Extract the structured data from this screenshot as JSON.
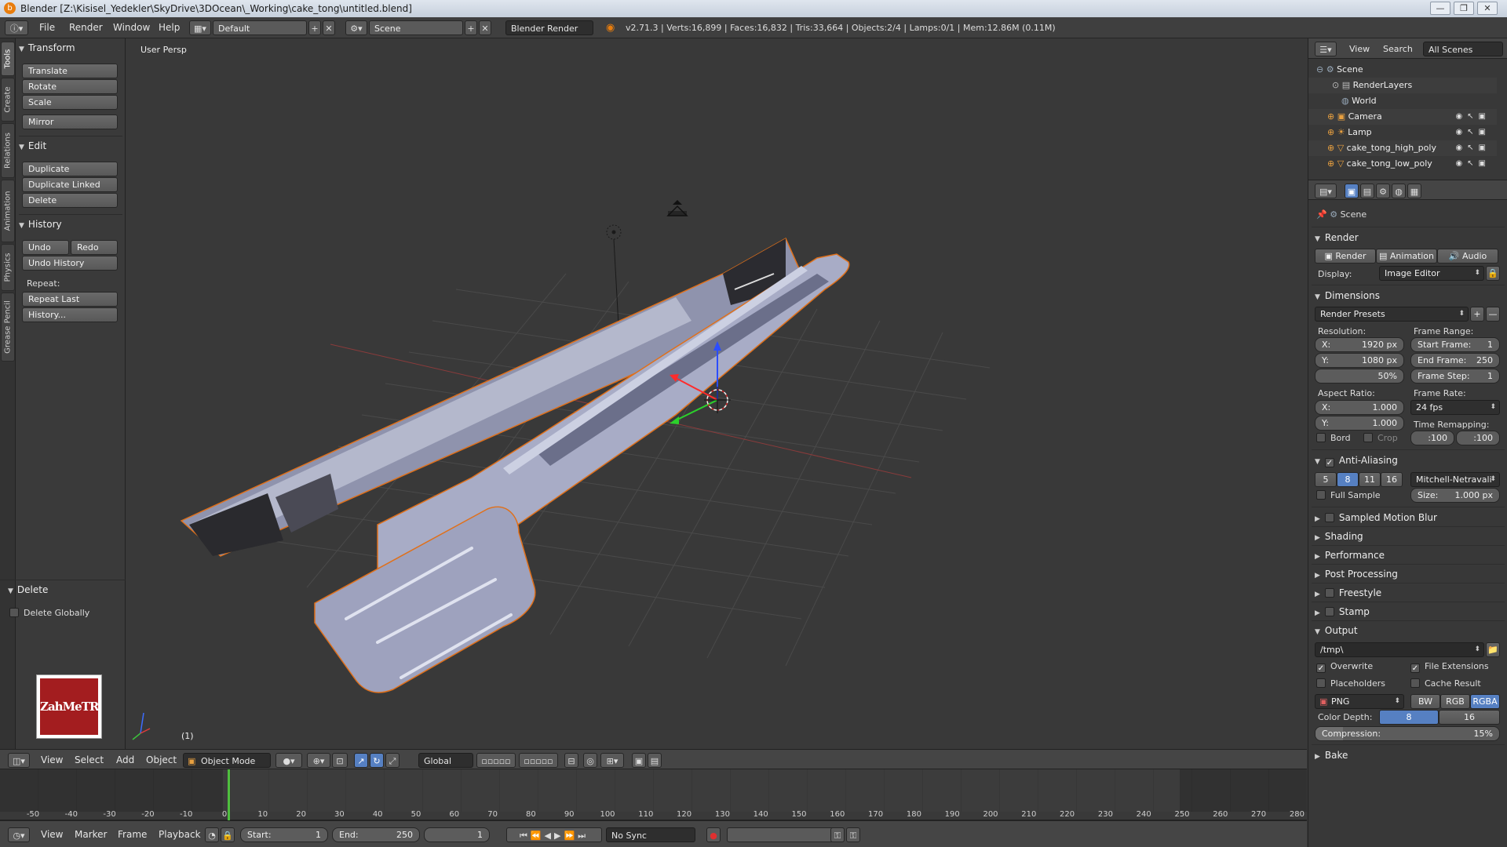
{
  "window": {
    "title": "Blender [Z:\\Kisisel_Yedekler\\SkyDrive\\3DOcean\\_Working\\cake_tong\\untitled.blend]",
    "controls": [
      "—",
      "❐",
      "✕"
    ]
  },
  "info_header": {
    "menus": [
      "File",
      "Render",
      "Window",
      "Help"
    ],
    "screen_layout": "Default",
    "scene": "Scene",
    "render_engine": "Blender Render",
    "stats": "v2.71.3 | Verts:16,899 | Faces:16,832 | Tris:33,664 | Objects:2/4 | Lamps:0/1 | Mem:12.86M (0.11M)"
  },
  "left_tabs": [
    "Tools",
    "Create",
    "Relations",
    "Animation",
    "Physics",
    "Grease Pencil"
  ],
  "tool_shelf": {
    "transform": {
      "title": "Transform",
      "buttons": [
        "Translate",
        "Rotate",
        "Scale",
        "Mirror"
      ]
    },
    "edit": {
      "title": "Edit",
      "buttons": [
        "Duplicate",
        "Duplicate Linked",
        "Delete"
      ]
    },
    "history": {
      "title": "History",
      "undo": "Undo",
      "redo": "Redo",
      "undo_history": "Undo History",
      "repeat_label": "Repeat:",
      "repeat_last": "Repeat Last",
      "history_btn": "History..."
    },
    "operator": {
      "title": "Delete",
      "option": "Delete Globally",
      "option_checked": false
    },
    "logo_text": "ZahMeTR"
  },
  "viewport": {
    "label": "User Persp",
    "frame_indicator": "(1)"
  },
  "view3d_header": {
    "menus": [
      "View",
      "Select",
      "Add",
      "Object"
    ],
    "mode": "Object Mode",
    "orientation": "Global"
  },
  "timeline": {
    "ticks": [
      "-50",
      "-40",
      "-30",
      "-20",
      "-10",
      "0",
      "10",
      "20",
      "30",
      "40",
      "50",
      "60",
      "70",
      "80",
      "90",
      "100",
      "110",
      "120",
      "130",
      "140",
      "150",
      "160",
      "170",
      "180",
      "190",
      "200",
      "210",
      "220",
      "230",
      "240",
      "250",
      "260",
      "270",
      "280"
    ],
    "current_frame": 1,
    "menus": [
      "View",
      "Marker",
      "Frame",
      "Playback"
    ],
    "start_label": "Start:",
    "start": "1",
    "end_label": "End:",
    "end": "250",
    "current": "1",
    "sync": "No Sync"
  },
  "outliner": {
    "menus": [
      "View",
      "Search"
    ],
    "filter": "All Scenes",
    "rows": [
      "Scene",
      "RenderLayers",
      "World",
      "Camera",
      "Lamp",
      "cake_tong_high_poly",
      "cake_tong_low_poly"
    ]
  },
  "properties": {
    "context": "Scene",
    "render": {
      "title": "Render",
      "render_btn": "Render",
      "animation_btn": "Animation",
      "audio_btn": "Audio",
      "display_label": "Display:",
      "display_value": "Image Editor"
    },
    "dimensions": {
      "title": "Dimensions",
      "presets": "Render Presets",
      "resolution_label": "Resolution:",
      "res_x_label": "X:",
      "res_x": "1920 px",
      "res_y_label": "Y:",
      "res_y": "1080 px",
      "res_pct": "50%",
      "frame_range_label": "Frame Range:",
      "start_frame_label": "Start Frame:",
      "start_frame": "1",
      "end_frame_label": "End Frame:",
      "end_frame": "250",
      "frame_step_label": "Frame Step:",
      "frame_step": "1",
      "aspect_label": "Aspect Ratio:",
      "aspect_x_label": "X:",
      "aspect_x": "1.000",
      "aspect_y_label": "Y:",
      "aspect_y": "1.000",
      "frame_rate_label": "Frame Rate:",
      "frame_rate": "24 fps",
      "time_remap_label": "Time Remapping:",
      "remap_old": ":100",
      "remap_new": ":100",
      "bord": "Bord",
      "crop": "Crop"
    },
    "antialiasing": {
      "title": "Anti-Aliasing",
      "samples": [
        "5",
        "8",
        "11",
        "16"
      ],
      "selected_sample": "8",
      "filter": "Mitchell-Netravali",
      "full_sample": "Full Sample",
      "size_label": "Size:",
      "size": "1.000 px"
    },
    "collapsed": [
      "Sampled Motion Blur",
      "Shading",
      "Performance",
      "Post Processing",
      "Freestyle",
      "Stamp"
    ],
    "output": {
      "title": "Output",
      "path": "/tmp\\",
      "overwrite": "Overwrite",
      "file_extensions": "File Extensions",
      "placeholders": "Placeholders",
      "cache_result": "Cache Result",
      "format": "PNG",
      "bw": "BW",
      "rgb": "RGB",
      "rgba": "RGBA",
      "color_depth_label": "Color Depth:",
      "depth_8": "8",
      "depth_16": "16",
      "compression_label": "Compression:",
      "compression": "15%",
      "compression_fraction": 0.15
    },
    "bake": "Bake"
  },
  "colors": {
    "selection_outline": "#e0701a",
    "accent_blue": "#5680c2",
    "frame_cursor": "#4fbf3f"
  }
}
